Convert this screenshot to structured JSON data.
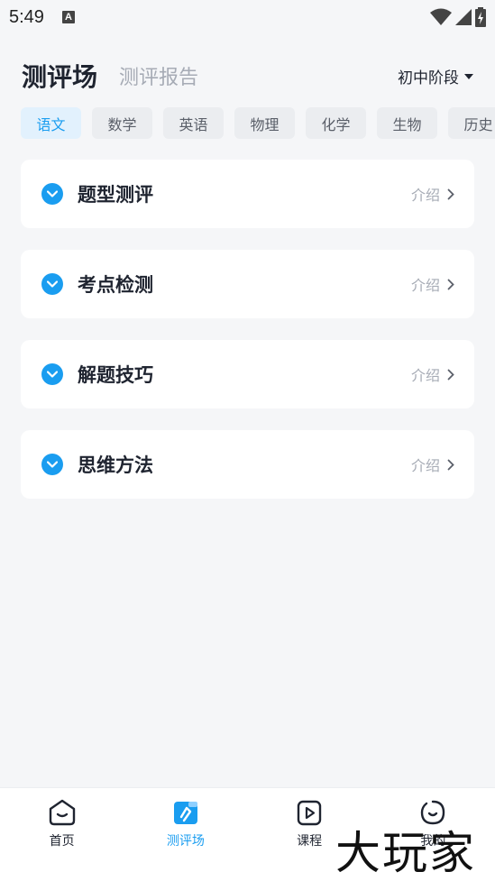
{
  "status_bar": {
    "time": "5:49",
    "notification_icon": "A"
  },
  "header": {
    "title": "测评场",
    "subtitle": "测评报告",
    "stage": "初中阶段"
  },
  "subjects": [
    "语文",
    "数学",
    "英语",
    "物理",
    "化学",
    "生物",
    "历史"
  ],
  "cards": [
    {
      "title": "题型测评",
      "intro": "介绍"
    },
    {
      "title": "考点检测",
      "intro": "介绍"
    },
    {
      "title": "解题技巧",
      "intro": "介绍"
    },
    {
      "title": "思维方法",
      "intro": "介绍"
    }
  ],
  "bottom_nav": [
    {
      "label": "首页",
      "icon": "home-icon"
    },
    {
      "label": "测评场",
      "icon": "test-arena-icon"
    },
    {
      "label": "课程",
      "icon": "course-play-icon"
    },
    {
      "label": "我的",
      "icon": "profile-icon"
    }
  ],
  "watermark": "大玩家",
  "colors": {
    "accent": "#1a9df0",
    "text": "#1f2430",
    "muted": "#a6abb5"
  }
}
